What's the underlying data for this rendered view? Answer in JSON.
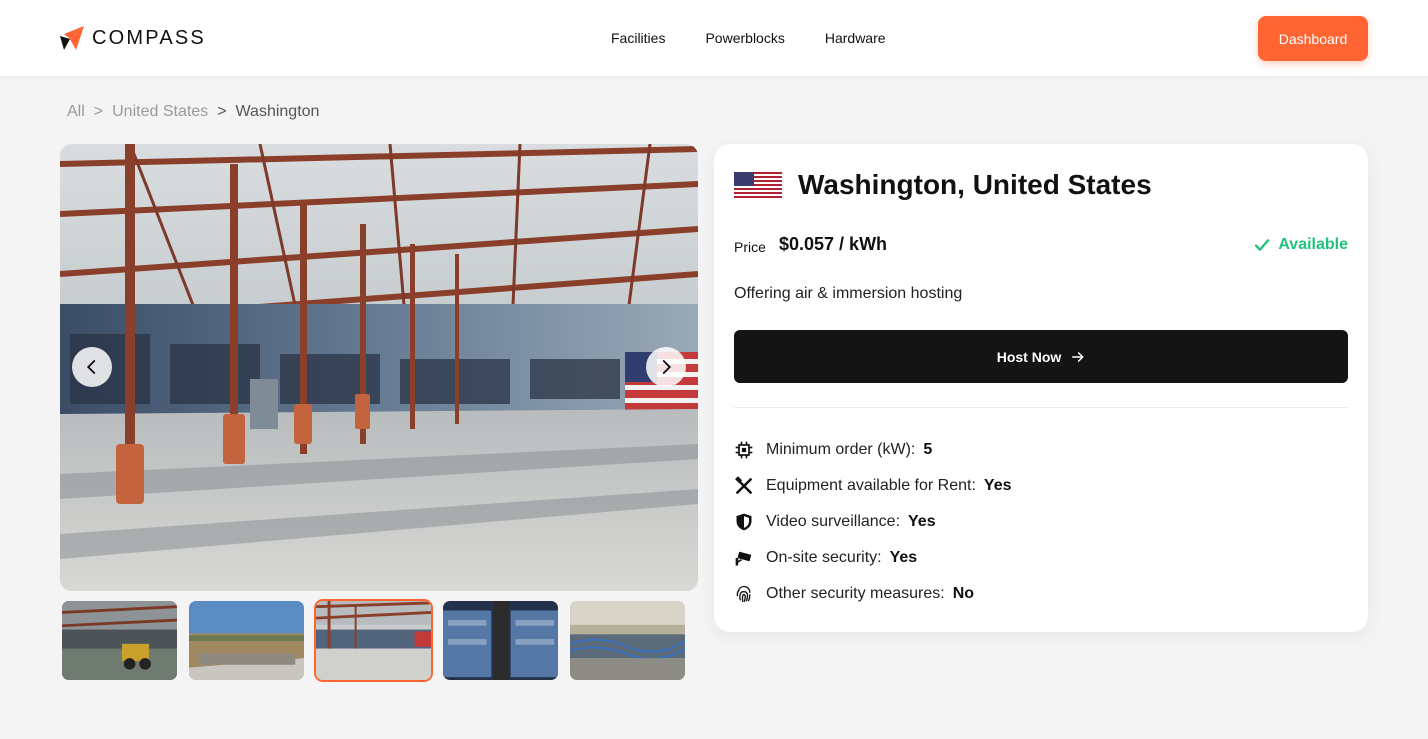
{
  "header": {
    "brand": "COMPASS",
    "nav": [
      "Facilities",
      "Powerblocks",
      "Hardware"
    ],
    "dashboard_label": "Dashboard"
  },
  "breadcrumb": {
    "items": [
      "All",
      "United States",
      "Washington"
    ],
    "separator": ">"
  },
  "gallery": {
    "thumbnails": [
      "warehouse-loader",
      "aerial-site",
      "warehouse-flag",
      "miner-rows",
      "cable-rack"
    ],
    "active_index": 2
  },
  "location": {
    "title": "Washington, United States",
    "price_label": "Price",
    "price_value": "$0.057 / kWh",
    "status": "Available",
    "offering": "Offering air & immersion hosting",
    "host_label": "Host Now"
  },
  "features": [
    {
      "icon": "chip-icon",
      "label": "Minimum order (kW):",
      "value": "5"
    },
    {
      "icon": "tools-icon",
      "label": "Equipment available for Rent:",
      "value": "Yes"
    },
    {
      "icon": "shield-icon",
      "label": "Video surveillance:",
      "value": "Yes"
    },
    {
      "icon": "security-camera-icon",
      "label": "On-site security:",
      "value": "Yes"
    },
    {
      "icon": "fingerprint-icon",
      "label": "Other security measures:",
      "value": "No"
    }
  ],
  "colors": {
    "accent": "#ff6533",
    "available": "#22c17c",
    "button_dark": "#141414",
    "background": "#f4f4f4"
  }
}
